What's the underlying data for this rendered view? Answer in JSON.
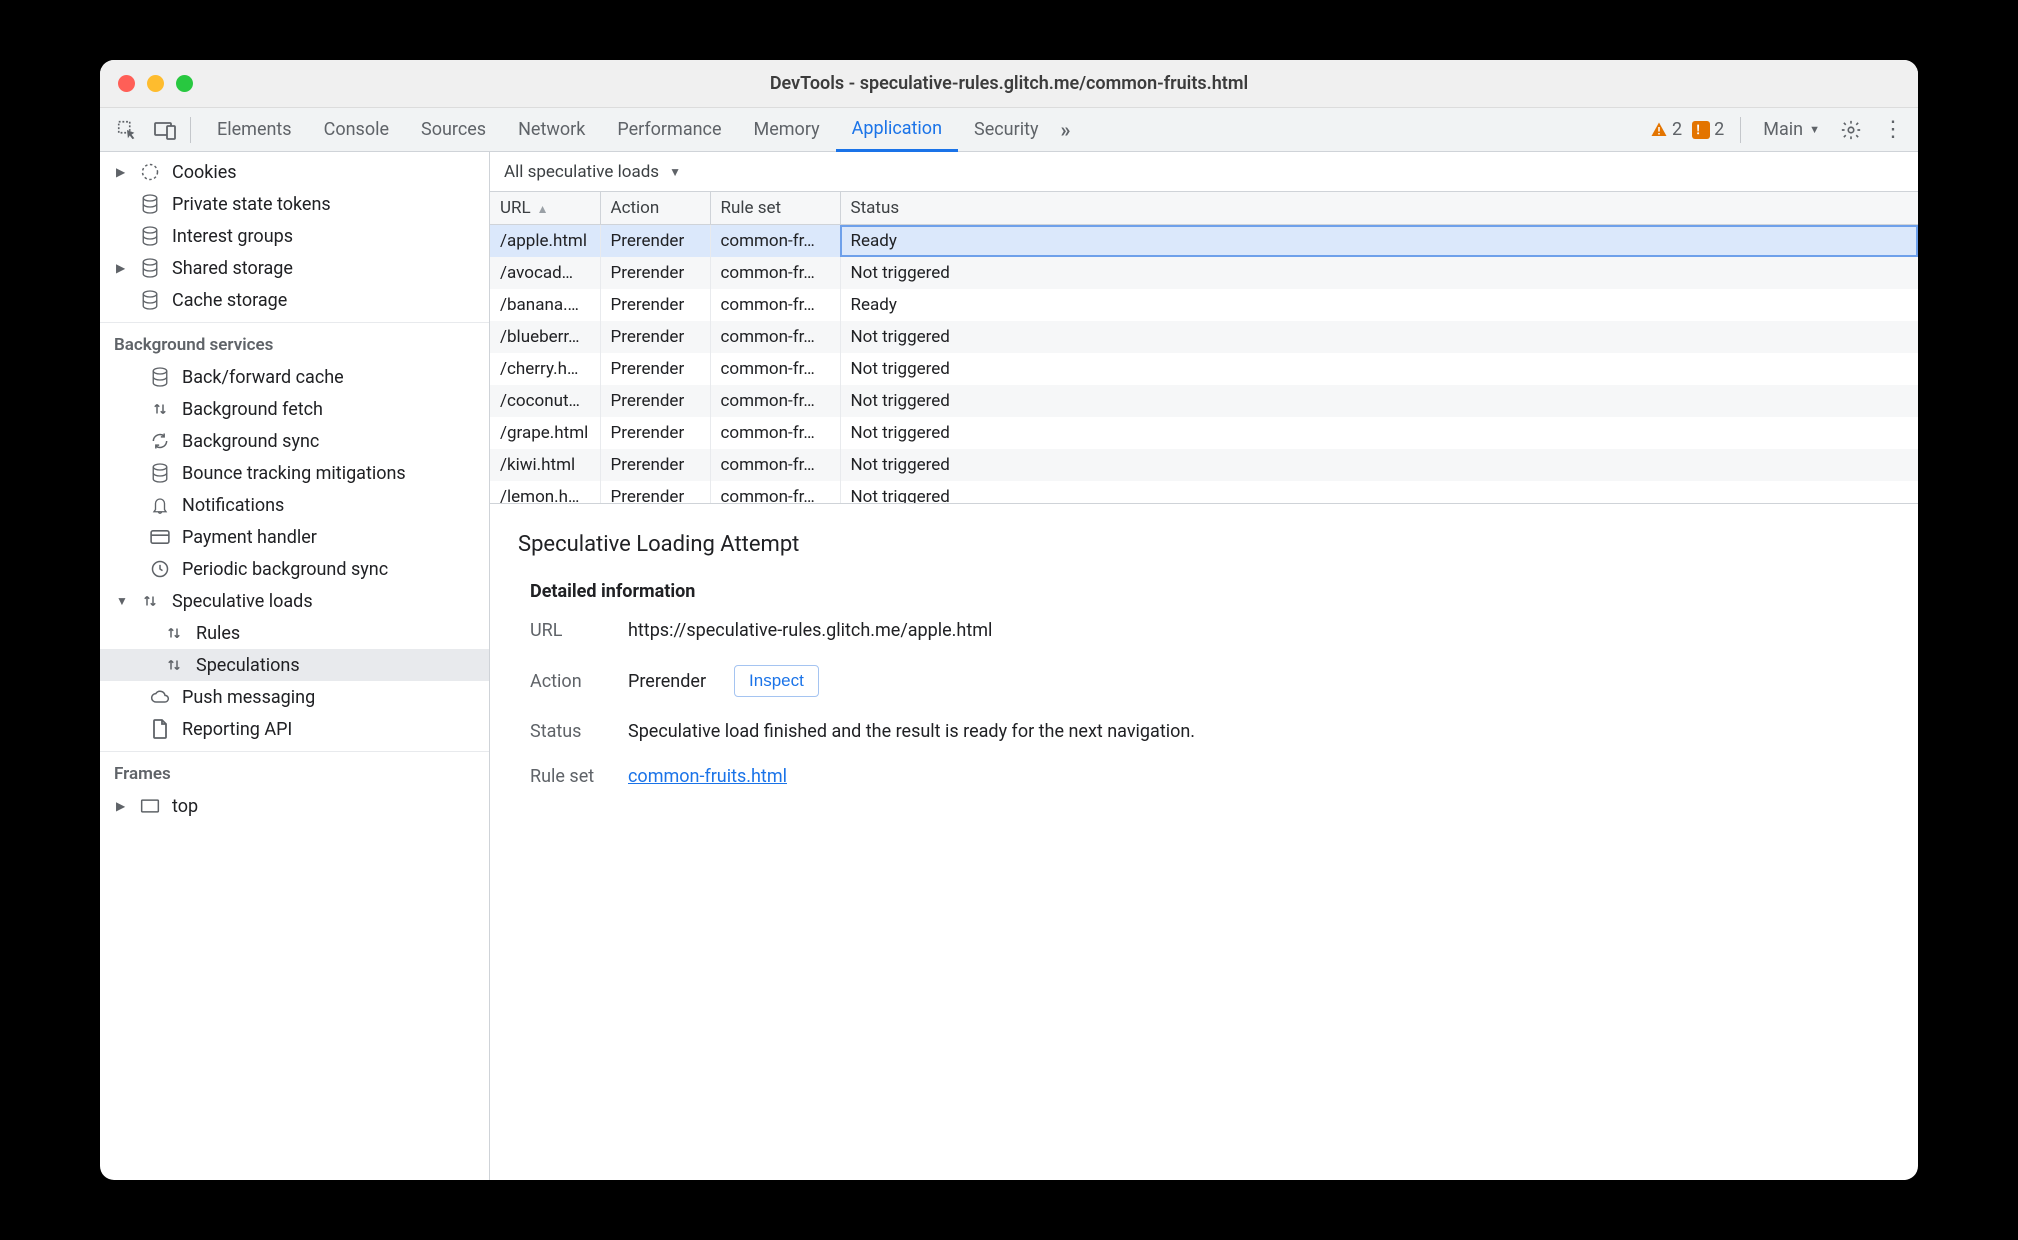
{
  "window": {
    "title": "DevTools - speculative-rules.glitch.me/common-fruits.html"
  },
  "toolbar": {
    "tabs": [
      "Elements",
      "Console",
      "Sources",
      "Network",
      "Performance",
      "Memory",
      "Application",
      "Security"
    ],
    "active_tab": "Application",
    "overflow": "»",
    "warn_count": "2",
    "issue_count": "2",
    "target_label": "Main",
    "target_caret": "▼"
  },
  "sidebar": {
    "storage": {
      "items": [
        {
          "label": "Cookies",
          "icon": "cookie",
          "tri": "▶"
        },
        {
          "label": "Private state tokens",
          "icon": "db",
          "tri": ""
        },
        {
          "label": "Interest groups",
          "icon": "db",
          "tri": ""
        },
        {
          "label": "Shared storage",
          "icon": "db",
          "tri": "▶"
        },
        {
          "label": "Cache storage",
          "icon": "db",
          "tri": ""
        }
      ]
    },
    "bg_heading": "Background services",
    "bg_items": [
      {
        "label": "Back/forward cache",
        "icon": "db"
      },
      {
        "label": "Background fetch",
        "icon": "updown"
      },
      {
        "label": "Background sync",
        "icon": "sync"
      },
      {
        "label": "Bounce tracking mitigations",
        "icon": "db"
      },
      {
        "label": "Notifications",
        "icon": "bell"
      },
      {
        "label": "Payment handler",
        "icon": "card"
      },
      {
        "label": "Periodic background sync",
        "icon": "clock"
      }
    ],
    "spec_label": "Speculative loads",
    "spec_children": [
      {
        "label": "Rules"
      },
      {
        "label": "Speculations",
        "selected": true
      }
    ],
    "push_label": "Push messaging",
    "report_label": "Reporting API",
    "frames_heading": "Frames",
    "frames_top": "top"
  },
  "panel": {
    "filter_label": "All speculative loads",
    "columns": [
      "URL",
      "Action",
      "Rule set",
      "Status"
    ],
    "rows": [
      {
        "url": "/apple.html",
        "action": "Prerender",
        "ruleset": "common-fr…",
        "status": "Ready",
        "selected": true
      },
      {
        "url": "/avocad…",
        "action": "Prerender",
        "ruleset": "common-fr…",
        "status": "Not triggered"
      },
      {
        "url": "/banana.…",
        "action": "Prerender",
        "ruleset": "common-fr…",
        "status": "Ready"
      },
      {
        "url": "/blueberr…",
        "action": "Prerender",
        "ruleset": "common-fr…",
        "status": "Not triggered"
      },
      {
        "url": "/cherry.h…",
        "action": "Prerender",
        "ruleset": "common-fr…",
        "status": "Not triggered"
      },
      {
        "url": "/coconut…",
        "action": "Prerender",
        "ruleset": "common-fr…",
        "status": "Not triggered"
      },
      {
        "url": "/grape.html",
        "action": "Prerender",
        "ruleset": "common-fr…",
        "status": "Not triggered"
      },
      {
        "url": "/kiwi.html",
        "action": "Prerender",
        "ruleset": "common-fr…",
        "status": "Not triggered"
      },
      {
        "url": "/lemon.h…",
        "action": "Prerender",
        "ruleset": "common-fr…",
        "status": "Not triggered"
      }
    ],
    "detail": {
      "heading": "Speculative Loading Attempt",
      "subheading": "Detailed information",
      "url_label": "URL",
      "url_value": "https://speculative-rules.glitch.me/apple.html",
      "action_label": "Action",
      "action_value": "Prerender",
      "inspect_label": "Inspect",
      "status_label": "Status",
      "status_value": "Speculative load finished and the result is ready for the next navigation.",
      "ruleset_label": "Rule set",
      "ruleset_value": "common-fruits.html"
    }
  }
}
